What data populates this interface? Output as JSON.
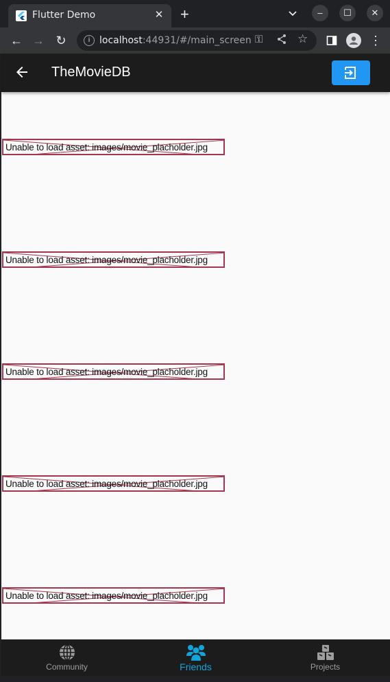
{
  "browser": {
    "tab_title": "Flutter Demo",
    "url_host": "localhost",
    "url_rest": ":44931/#/main_screen",
    "icons": [
      "flutter-favicon",
      "close-tab-icon",
      "new-tab-icon",
      "tab-search-icon",
      "minimize-icon",
      "maximize-icon",
      "close-window-icon",
      "back-icon",
      "forward-icon",
      "reload-icon",
      "info-icon",
      "key-icon",
      "share-icon",
      "star-icon",
      "side-panel-icon",
      "profile-icon",
      "menu-icon"
    ]
  },
  "appbar": {
    "title": "TheMovieDB",
    "back_icon": "arrow-back-icon",
    "action_icon": "login-icon",
    "action_color": "#2196f3"
  },
  "content": {
    "items": [
      {
        "error": "Unable to load asset: images/movie_placholder.jpg"
      },
      {
        "error": "Unable to load asset: images/movie_placholder.jpg"
      },
      {
        "error": "Unable to load asset: images/movie_placholder.jpg"
      },
      {
        "error": "Unable to load asset: images/movie_placholder.jpg"
      },
      {
        "error": "Unable to load asset: images/movie_placholder.jpg"
      }
    ]
  },
  "bottom_nav": {
    "items": [
      {
        "label": "Community",
        "icon": "globe-icon",
        "active": false
      },
      {
        "label": "Friends",
        "icon": "people-icon",
        "active": true
      },
      {
        "label": "Projects",
        "icon": "cubes-icon",
        "active": false
      }
    ],
    "active_color": "#12a3db",
    "inactive_color": "#9e9e9e"
  }
}
